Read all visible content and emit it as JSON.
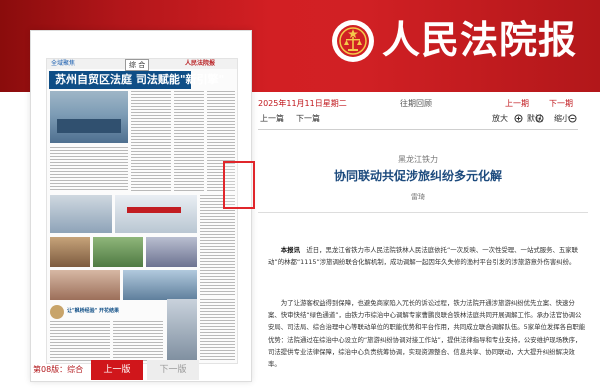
{
  "header": {
    "logo_text": "人民法院报",
    "brand_color": "#d12024",
    "emblem_icon": "court-emblem-icon"
  },
  "newspaper": {
    "edition_tag": "全域聚焦",
    "section_tag": "综 合",
    "masthead": "人民法院报",
    "headline": "苏州自贸区法庭 司法赋能\"新引擎\"",
    "caption": "让\"枫桥经验\" 开花结果"
  },
  "page_nav": {
    "page_label": "第08版：综合",
    "prev_page": "上一版",
    "next_page": "下一版"
  },
  "reader": {
    "date": "2025年11月11日星期二",
    "back_to_list": "往期回顾",
    "prev_edition": "上一期",
    "next_edition": "下一期",
    "toolbar": {
      "prev_article": "上一篇",
      "next_article": "下一篇",
      "zoom_in": "放大",
      "zoom_in_icon": "zoom-in-icon",
      "zoom_reset": "默认",
      "zoom_reset_icon": "reset-icon",
      "zoom_out": "缩小",
      "zoom_out_icon": "zoom-out-icon"
    }
  },
  "article": {
    "kicker": "黑龙江铁力",
    "title": "协同联动共促涉旅纠纷多元化解",
    "author": "雷琦",
    "lead_label": "本报讯",
    "para1": "近日，黑龙江省铁力市人民法院铁林人民法庭依托“一次反映、一次性受理、一站式服务、五家联动”的林都“1115”涉旅调纷联合化解机制，成功调解一起因年久失修的渔村平台引发的涉旅游意外伤害纠纷。",
    "para2": "为了让游客权益得到保障，也避免商家陷入冗长的诉讼过程，铁力法院开通涉旅游纠纷优先立案、快速分案、快审快结“绿色通道”，由铁力市综治中心调解专家曹鹏良联合铁林法庭共同开展调解工作。承办法官协调公安局、司法局、综合治理中心等联动单位的职能优势和平台作用，共同成立联合调解队伍。5家单位发挥各自职能优势：法院通过在综治中心设立的“旅游纠纷协调对接工作站”，提供法律指导和专业支持，公安维护现场秩序，司法提供专业法律保障，综治中心负责统筹协调，实现资源整合、信息共享、协同联动，大大提升纠纷解决效率。"
  }
}
